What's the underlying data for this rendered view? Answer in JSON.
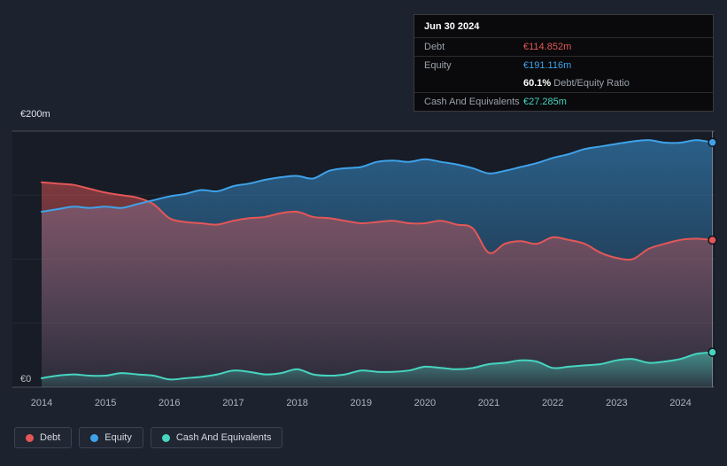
{
  "colors": {
    "background": "#1c222e",
    "debt": "#e45757",
    "equity": "#3fa2e9",
    "cash": "#47d4c0"
  },
  "tooltip": {
    "date": "Jun 30 2024",
    "debt_label": "Debt",
    "debt_value": "€114.852m",
    "equity_label": "Equity",
    "equity_value": "€191.116m",
    "ratio_value": "60.1%",
    "ratio_label": " Debt/Equity Ratio",
    "cash_label": "Cash And Equivalents",
    "cash_value": "€27.285m"
  },
  "legend": [
    {
      "key": "debt",
      "label": "Debt"
    },
    {
      "key": "equity",
      "label": "Equity"
    },
    {
      "key": "cash",
      "label": "Cash And Equivalents"
    }
  ],
  "chart_data": {
    "type": "area",
    "y_top_label": "€200m",
    "y_zero_label": "€0",
    "ylim": [
      0,
      200
    ],
    "xlim": [
      2014,
      2024.5
    ],
    "y_gridlines": [
      0,
      50,
      100,
      150,
      200
    ],
    "x_ticks": [
      2014,
      2015,
      2016,
      2017,
      2018,
      2019,
      2020,
      2021,
      2022,
      2023,
      2024
    ],
    "crosshair_x": 2024.5,
    "hover_values": {
      "debt": 114.852,
      "equity": 191.116,
      "cash": 27.285,
      "debt_equity_ratio_pct": 60.1
    },
    "x": [
      2014,
      2014.25,
      2014.5,
      2014.75,
      2015,
      2015.25,
      2015.5,
      2015.75,
      2016,
      2016.25,
      2016.5,
      2016.75,
      2017,
      2017.25,
      2017.5,
      2017.75,
      2018,
      2018.25,
      2018.5,
      2018.75,
      2019,
      2019.25,
      2019.5,
      2019.75,
      2020,
      2020.25,
      2020.5,
      2020.75,
      2021,
      2021.25,
      2021.5,
      2021.75,
      2022,
      2022.25,
      2022.5,
      2022.75,
      2023,
      2023.25,
      2023.5,
      2023.75,
      2024,
      2024.25,
      2024.5
    ],
    "series": [
      {
        "key": "equity",
        "name": "Equity",
        "values": [
          137,
          139,
          141,
          140,
          141,
          140,
          143,
          146,
          149,
          151,
          154,
          153,
          157,
          159,
          162,
          164,
          165,
          163,
          169,
          171,
          172,
          176,
          177,
          176,
          178,
          176,
          174,
          171,
          167,
          169,
          172,
          175,
          179,
          182,
          186,
          188,
          190,
          192,
          193,
          191,
          191,
          193,
          191.116
        ]
      },
      {
        "key": "debt",
        "name": "Debt",
        "values": [
          160,
          159,
          158,
          155,
          152,
          150,
          148,
          143,
          132,
          129,
          128,
          127,
          130,
          132,
          133,
          136,
          137,
          133,
          132,
          130,
          128,
          129,
          130,
          128,
          128,
          130,
          127,
          124,
          105,
          112,
          114,
          112,
          117,
          115,
          112,
          105,
          101,
          100,
          108,
          112,
          115,
          116,
          114.852
        ]
      },
      {
        "key": "cash",
        "name": "Cash And Equivalents",
        "values": [
          7,
          9,
          10,
          9,
          9,
          11,
          10,
          9,
          6,
          7,
          8,
          10,
          13,
          12,
          10,
          11,
          14,
          10,
          9,
          10,
          13,
          12,
          12,
          13,
          16,
          15,
          14,
          15,
          18,
          19,
          21,
          20,
          15,
          16,
          17,
          18,
          21,
          22,
          19,
          20,
          22,
          26,
          27.285
        ]
      }
    ]
  }
}
